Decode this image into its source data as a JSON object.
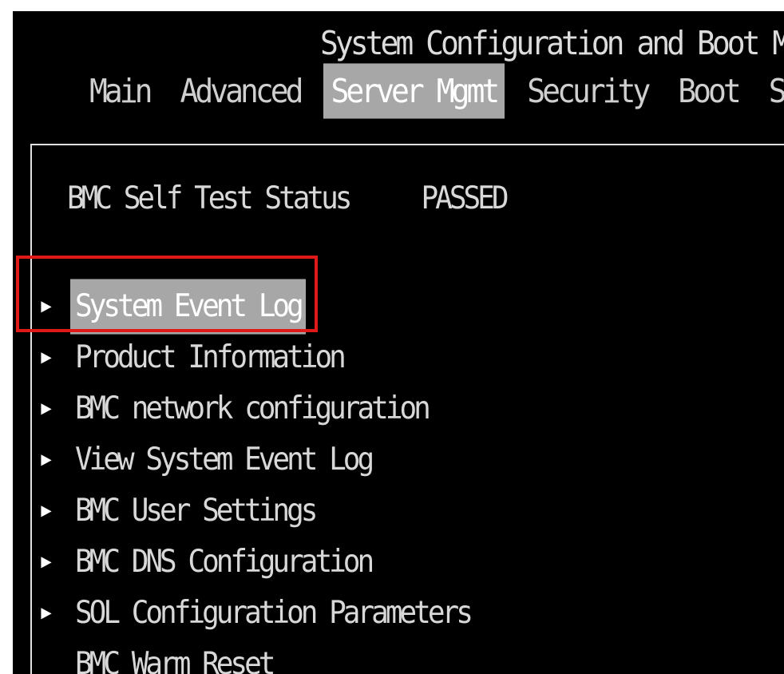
{
  "header": {
    "title": "System Configuration and Boot Ma"
  },
  "tabs": [
    {
      "label": "Main",
      "active": false
    },
    {
      "label": "Advanced",
      "active": false
    },
    {
      "label": "Server Mgmt",
      "active": true
    },
    {
      "label": "Security",
      "active": false
    },
    {
      "label": "Boot",
      "active": false
    },
    {
      "label": "Sa",
      "active": false
    }
  ],
  "status": {
    "label": "BMC Self Test Status",
    "value": "PASSED"
  },
  "menu": {
    "items": [
      {
        "label": "System Event Log",
        "selected": true,
        "has_submenu": true
      },
      {
        "label": "Product Information",
        "selected": false,
        "has_submenu": true
      },
      {
        "label": "BMC network configuration",
        "selected": false,
        "has_submenu": true
      },
      {
        "label": "View System Event Log",
        "selected": false,
        "has_submenu": true
      },
      {
        "label": "BMC User Settings",
        "selected": false,
        "has_submenu": true
      },
      {
        "label": "BMC DNS Configuration",
        "selected": false,
        "has_submenu": true
      },
      {
        "label": "SOL Configuration Parameters",
        "selected": false,
        "has_submenu": true
      },
      {
        "label": "BMC Warm Reset",
        "selected": false,
        "has_submenu": false
      }
    ]
  },
  "icons": {
    "submenu": "triangle-right-icon"
  },
  "colors": {
    "background": "#000000",
    "text": "#d8d8d8",
    "selection_bg": "#a7a7a7",
    "highlight_box": "#e01919"
  }
}
